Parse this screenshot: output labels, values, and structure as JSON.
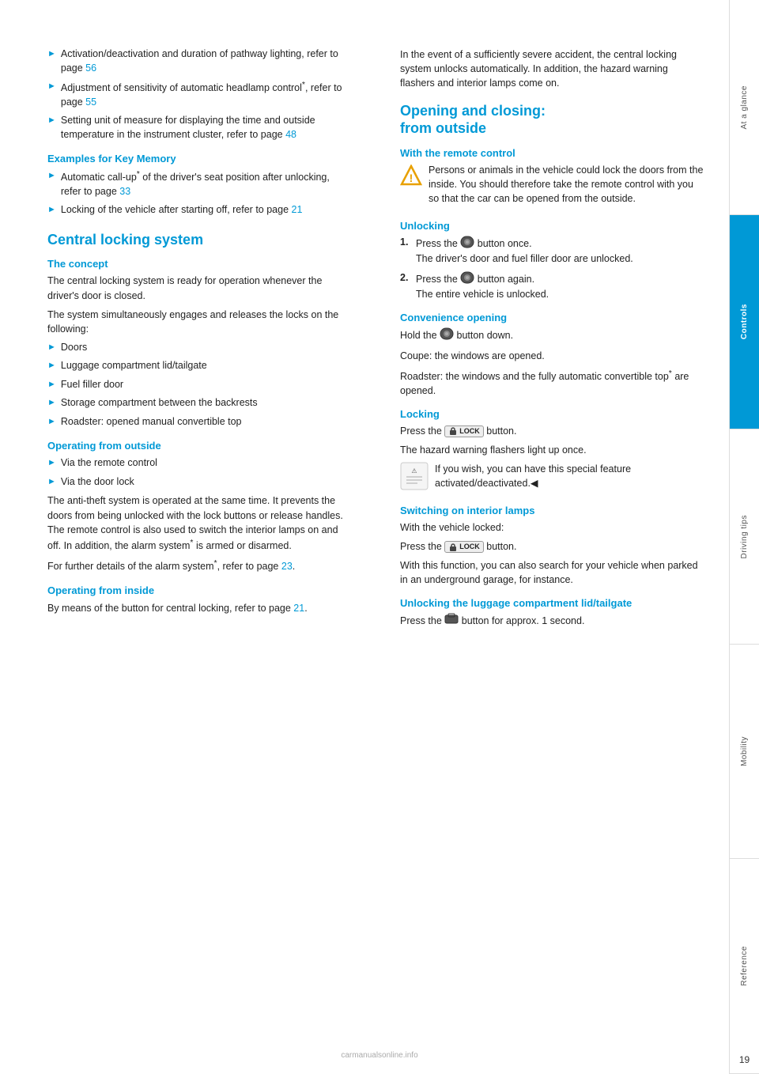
{
  "sidebar": {
    "sections": [
      {
        "label": "At a glance",
        "active": false
      },
      {
        "label": "Controls",
        "active": true
      },
      {
        "label": "Driving tips",
        "active": false
      },
      {
        "label": "Mobility",
        "active": false
      },
      {
        "label": "Reference",
        "active": false
      }
    ]
  },
  "page_number": "19",
  "left_column": {
    "intro_bullets": [
      {
        "text": "Activation/deactivation and duration of pathway lighting, refer to page ",
        "link": "56"
      },
      {
        "text": "Adjustment of sensitivity of automatic headlamp control",
        "superscript": "*",
        "suffix": ", refer to page ",
        "link": "55"
      },
      {
        "text": "Setting unit of measure for displaying the time and outside temperature in the instrument cluster, refer to page ",
        "link": "48"
      }
    ],
    "examples_heading": "Examples for Key Memory",
    "examples_bullets": [
      {
        "text": "Automatic call-up",
        "superscript": "*",
        "suffix": " of the driver's seat position after unlocking, refer to page ",
        "link": "33"
      },
      {
        "text": "Locking of the vehicle after starting off, refer to page ",
        "link": "21"
      }
    ],
    "central_locking_heading": "Central locking system",
    "concept_heading": "The concept",
    "concept_paragraphs": [
      "The central locking system is ready for operation whenever the driver's door is closed.",
      "The system simultaneously engages and releases the locks on the following:"
    ],
    "locks_bullets": [
      "Doors",
      "Luggage compartment lid/tailgate",
      "Fuel filler door",
      "Storage compartment between the backrests",
      "Roadster: opened manual convertible top"
    ],
    "operating_outside_heading": "Operating from outside",
    "operating_outside_bullets": [
      "Via the remote control",
      "Via the door lock"
    ],
    "operating_outside_paragraph": "The anti-theft system is operated at the same time. It prevents the doors from being unlocked with the lock buttons or release handles. The remote control is also used to switch the interior lamps on and off. In addition, the alarm system",
    "operating_outside_superscript": "*",
    "operating_outside_paragraph2": " is armed or disarmed.",
    "alarm_system_text": "For further details of the alarm system",
    "alarm_superscript": "*",
    "alarm_suffix": ", refer to page ",
    "alarm_link": "23",
    "operating_inside_heading": "Operating from inside",
    "operating_inside_text": "By means of the button for central locking, refer to page ",
    "operating_inside_link": "21"
  },
  "right_column": {
    "intro_text": "In the event of a sufficiently severe accident, the central locking system unlocks automatically. In addition, the hazard warning flashers and interior lamps come on.",
    "opening_closing_heading": "Opening and closing:\nfrom outside",
    "remote_control_heading": "With the remote control",
    "warning_text": "Persons or animals in the vehicle could lock the doors from the inside. You should therefore take the remote control with you so that the car can be opened from the outside.",
    "unlocking_heading": "Unlocking",
    "unlocking_steps": [
      {
        "num": "1.",
        "text": "Press the  button once.\nThe driver's door and fuel filler door are unlocked."
      },
      {
        "num": "2.",
        "text": "Press the  button again.\nThe entire vehicle is unlocked."
      }
    ],
    "convenience_heading": "Convenience opening",
    "convenience_text1": "Hold the  button down.",
    "convenience_text2": "Coupe: the windows are opened.",
    "convenience_text3": "Roadster: the windows and the fully automatic convertible top",
    "convenience_superscript": "*",
    "convenience_text4": " are opened.",
    "locking_heading": "Locking",
    "locking_text1": "Press the  LOCK button.",
    "locking_text2": "The hazard warning flashers light up once.",
    "locking_note": "If you wish, you can have this special feature activated/deactivated.",
    "switching_heading": "Switching on interior lamps",
    "switching_text1": "With the vehicle locked:",
    "switching_text2": "Press the  LOCK button.",
    "switching_text3": "With this function, you can also search for your vehicle when parked in an underground garage, for instance.",
    "luggage_heading": "Unlocking the luggage compartment lid/tailgate",
    "luggage_text": "Press the  button for approx. 1 second.",
    "watermark": "carmanualsonline.info"
  }
}
